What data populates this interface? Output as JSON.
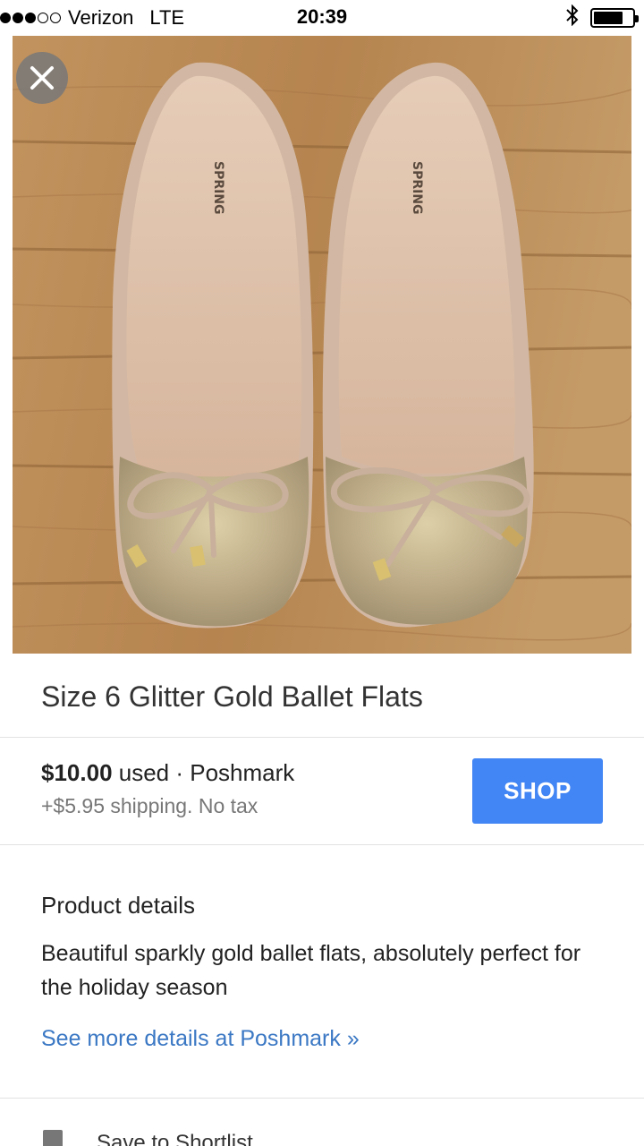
{
  "status_bar": {
    "carrier": "Verizon",
    "network": "LTE",
    "time": "20:39",
    "bluetooth_icon": "bluetooth-icon",
    "battery_icon": "battery-icon",
    "battery_level": 0.75
  },
  "hero": {
    "image_icon": "product-photo",
    "close_icon": "close-icon",
    "insole_brand": "SPRING"
  },
  "product": {
    "title": "Size 6 Glitter Gold Ballet Flats",
    "price": "$10.00",
    "condition_seller": " used · Poshmark",
    "shipping": "+$5.95 shipping. No tax",
    "shop_label": "SHOP"
  },
  "details": {
    "heading": "Product details",
    "description": "Beautiful sparkly gold ballet flats, absolutely perfect for the holiday season",
    "more_link": "See more details at Poshmark »"
  },
  "save": {
    "label": "Save to Shortlist",
    "icon": "bookmark-icon"
  },
  "colors": {
    "accent": "#4285f4",
    "link": "#3b78c4"
  }
}
